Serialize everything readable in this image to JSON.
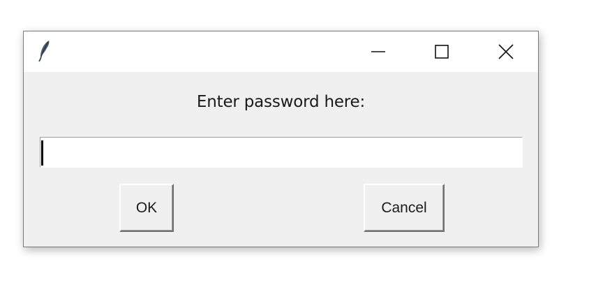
{
  "window": {
    "title": "",
    "icon": "feather-icon",
    "controls": [
      "minimize-icon",
      "maximize-icon",
      "close-icon"
    ]
  },
  "dialog": {
    "prompt": "Enter password here:",
    "password_value": "",
    "ok_label": "OK",
    "cancel_label": "Cancel"
  }
}
